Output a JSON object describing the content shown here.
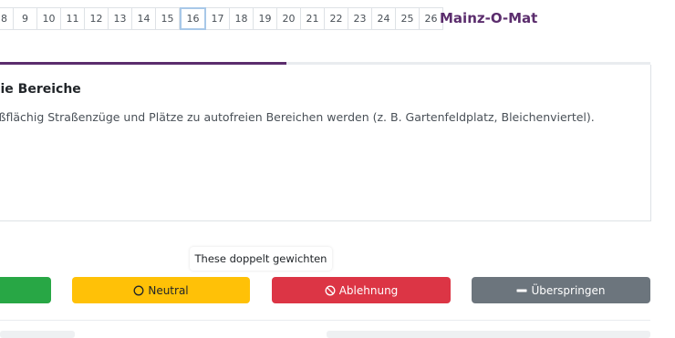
{
  "pagination": {
    "pages": [
      "8",
      "9",
      "10",
      "11",
      "12",
      "13",
      "14",
      "15",
      "16",
      "17",
      "18",
      "19",
      "20",
      "21",
      "22",
      "23",
      "24",
      "25",
      "26"
    ],
    "active": "16"
  },
  "brand": "Mainz-O-Mat",
  "progress": {
    "fraction": 0.44,
    "color": "#5b2d6d"
  },
  "thesis": {
    "title": "eie Bereiche",
    "text": "oßflächig Straßenzüge und Plätze zu autofreien Bereichen werden (z. B. Gartenfeldplatz, Bleichenviertel)."
  },
  "tooltip": "These doppelt gewichten",
  "buttons": {
    "agree": {
      "color": "#28a745"
    },
    "neutral": {
      "label": "Neutral",
      "icon": "circle-icon",
      "color": "#ffc107"
    },
    "reject": {
      "label": "Ablehnung",
      "icon": "ban-icon",
      "color": "#dc3545"
    },
    "skip": {
      "label": "Überspringen",
      "icon": "minus-icon",
      "color": "#6c757d"
    }
  }
}
